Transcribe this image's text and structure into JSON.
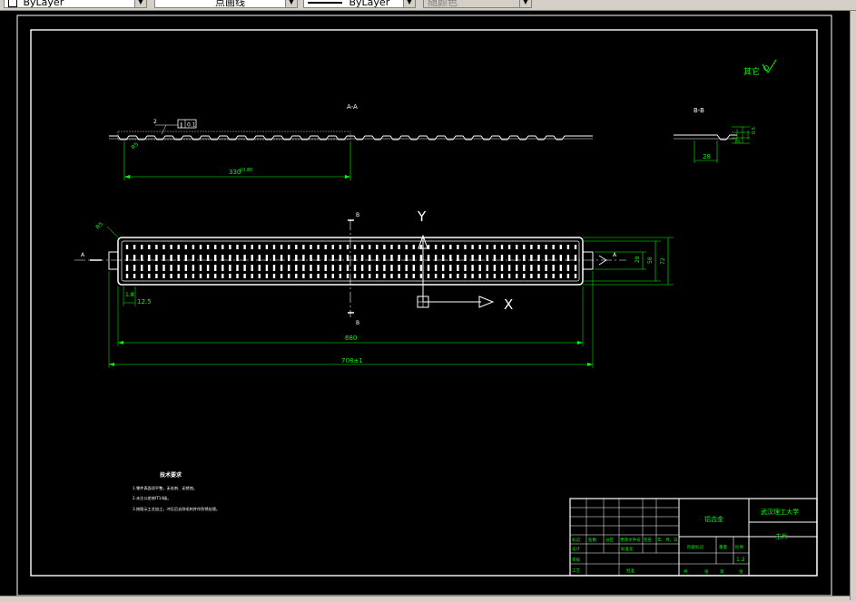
{
  "toolbar": {
    "color_control": "ByLayer",
    "linetype_control": "点画线",
    "lineweight_control": "ByLayer",
    "plotstyle_control": "随颜色"
  },
  "drawing": {
    "roughness_label": "其它",
    "section_aa_label": "A-A",
    "section_bb_label": "B-B",
    "dim_330": "330",
    "dim_330_tol": "±0.80",
    "dim_28": "28",
    "dim_0_5": "0.5",
    "dim_r5": "R5",
    "dim_r5b": "R5",
    "dim_chamfer": "2",
    "flatness_value": "0.1",
    "dim_680": "680",
    "dim_708": "708±1",
    "dim_12_5": "12.5",
    "dim_1_8": "1.8",
    "dim_28b": "28",
    "dim_58": "58",
    "dim_72": "72",
    "marker_b": "B",
    "marker_a": "A",
    "axis_y": "Y",
    "axis_x": "X"
  },
  "notes": {
    "title": "技术要求",
    "lines": [
      "1.零件表面须平整，无毛刺、无锈蚀。",
      "2.未注公差按IT14级。",
      "3.按图示工艺加工，冲压后去除毛刺并作防锈处理。"
    ]
  },
  "title_block": {
    "material": "铝合金",
    "school": "武汉理工大学",
    "part_name": "主片",
    "scale": "1:2",
    "header_labels": [
      "标记",
      "处数",
      "分区",
      "更改文件号",
      "签名",
      "年、月、日"
    ],
    "design": "设计",
    "standardize": "标准化",
    "review": "审核",
    "process": "工艺",
    "approve": "批准",
    "stage_mark": "阶段标记",
    "weight": "重量",
    "scale_label": "比例",
    "sheet_total": "共",
    "sheet_label": "张",
    "sheet_num": "第",
    "sheet_unit": "张"
  }
}
